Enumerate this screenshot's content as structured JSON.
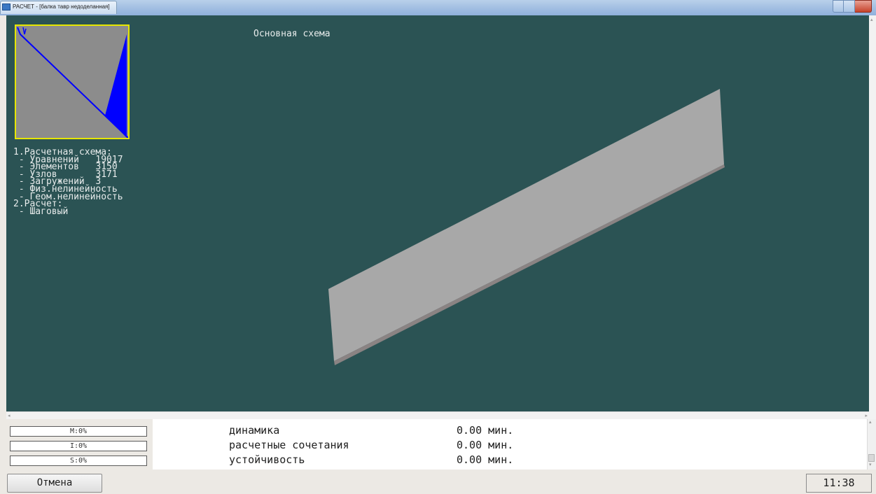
{
  "window": {
    "title": "РАСЧЕТ - [балка тавр недоделанная]"
  },
  "viewport": {
    "title": "Основная схема"
  },
  "info": {
    "lines": [
      "1.Расчетная схема:",
      " - Уравнений   19017",
      " - Элементов   3150",
      " - Узлов       3171",
      " - Загружений  3",
      " - Физ.нелинейность",
      " - Геом.нелинейность",
      "2.Расчет:",
      " - Шаговый"
    ]
  },
  "status": {
    "m": "M:0%",
    "i": "I:0%",
    "s": "S:0%"
  },
  "log": [
    {
      "name": "динамика",
      "time": "0.00 мин."
    },
    {
      "name": "расчетные сочетания",
      "time": "0.00 мин."
    },
    {
      "name": "устойчивость",
      "time": "0.00 мин."
    }
  ],
  "buttons": {
    "cancel": "Отмена"
  },
  "clock": "11:38",
  "colors": {
    "viewport_bg": "#2b5354",
    "overview_border": "#e6e600",
    "overview_plot": "#0000ff",
    "beam_fill": "#a8a8a8"
  }
}
